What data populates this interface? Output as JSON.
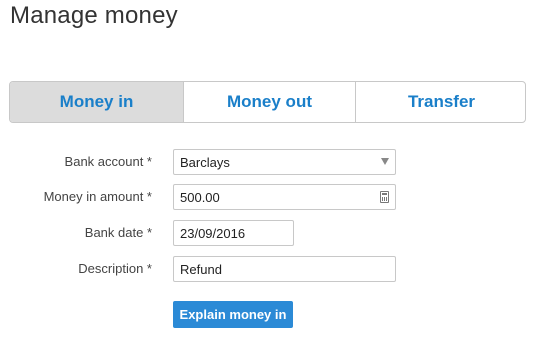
{
  "page": {
    "title": "Manage money"
  },
  "tabs": [
    {
      "label": "Money in",
      "active": true
    },
    {
      "label": "Money out",
      "active": false
    },
    {
      "label": "Transfer",
      "active": false
    }
  ],
  "form": {
    "bank_account": {
      "label": "Bank account *",
      "value": "Barclays"
    },
    "amount": {
      "label": "Money in amount *",
      "value": "500.00"
    },
    "date": {
      "label": "Bank date *",
      "value": "23/09/2016"
    },
    "description": {
      "label": "Description *",
      "value": "Refund"
    },
    "submit_label": "Explain money in"
  },
  "icons": {
    "select": "chevron-down-icon",
    "amount": "calculator-icon"
  },
  "colors": {
    "accent": "#2b8ad6",
    "tab_text": "#1a7fc9",
    "active_tab_bg": "#dcdcdc"
  }
}
